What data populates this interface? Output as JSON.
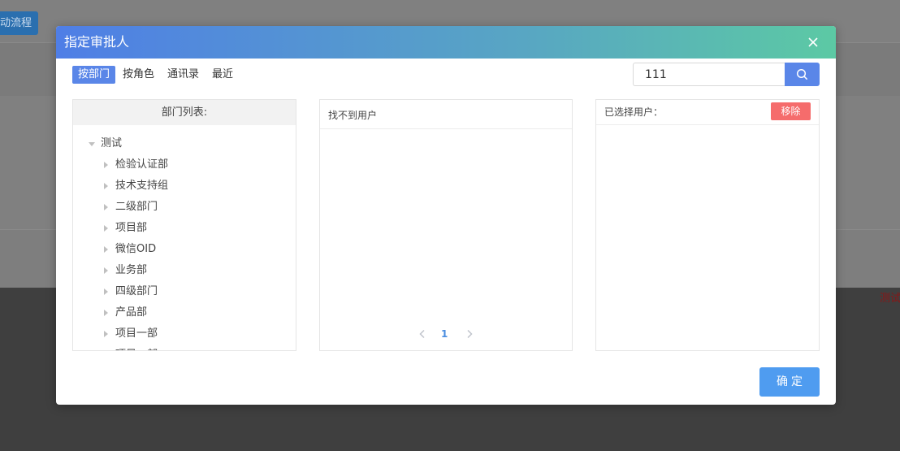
{
  "background": {
    "button_label": "动流程",
    "edge_text": "测试"
  },
  "dialog": {
    "title": "指定审批人",
    "tabs": [
      {
        "label": "按部门",
        "active": true
      },
      {
        "label": "按角色",
        "active": false
      },
      {
        "label": "通讯录",
        "active": false
      },
      {
        "label": "最近",
        "active": false
      }
    ],
    "search": {
      "value": "111"
    },
    "department_panel": {
      "header": "部门列表:",
      "root": {
        "label": "测试",
        "expanded": true
      },
      "children": [
        {
          "label": "检验认证部"
        },
        {
          "label": "技术支持组"
        },
        {
          "label": "二级部门"
        },
        {
          "label": "项目部"
        },
        {
          "label": "微信OID"
        },
        {
          "label": "业务部"
        },
        {
          "label": "四级部门"
        },
        {
          "label": "产品部"
        },
        {
          "label": "项目一部"
        },
        {
          "label": "项目二部"
        }
      ]
    },
    "users_panel": {
      "header": "找不到用户",
      "pagination": {
        "current_page": "1"
      }
    },
    "selected_panel": {
      "header": "已选择用户：",
      "remove_label": "移除"
    },
    "confirm_label": "确定",
    "colors": {
      "primary": "#5a86e8",
      "confirm": "#4f9cf0",
      "danger": "#f56c6c",
      "header_gradient_start": "#4f7ee6",
      "header_gradient_end": "#5cc9a4"
    }
  }
}
